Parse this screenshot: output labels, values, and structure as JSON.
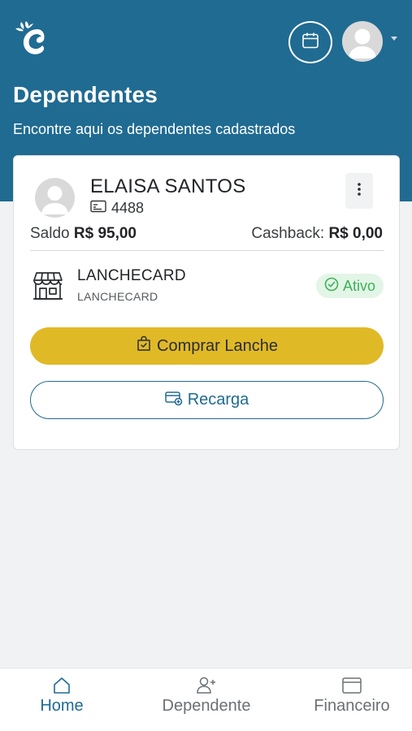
{
  "header": {
    "title": "Dependentes",
    "subtitle": "Encontre aqui os dependentes cadastrados"
  },
  "colors": {
    "primary": "#206b92",
    "accent_yellow": "#e0b926",
    "status_green": "#3cb25a",
    "status_green_bg": "#e3f5e6"
  },
  "icons": {
    "logo": "brand-logo-icon",
    "calendar": "calendar-icon",
    "avatar": "user-avatar-icon",
    "menu": "more-vertical-icon",
    "card_id": "id-card-icon",
    "store": "store-icon",
    "status": "check-circle-icon",
    "buy": "shopping-bag-check-icon",
    "recharge": "card-add-icon",
    "home": "home-icon",
    "dependente": "user-plus-icon",
    "financeiro": "wallet-icon"
  },
  "dependent": {
    "name": "ELAISA SANTOS",
    "id": "4488",
    "saldo_label": "Saldo",
    "saldo_value": "R$ 95,00",
    "cashback_label": "Cashback:",
    "cashback_value": "R$ 0,00",
    "service": {
      "name": "LANCHECARD",
      "sub": "LANCHECARD",
      "status": "Ativo"
    },
    "buy_label": "Comprar Lanche",
    "recharge_label": "Recarga"
  },
  "nav": {
    "home": "Home",
    "dependente": "Dependente",
    "financeiro": "Financeiro",
    "active": "home"
  }
}
